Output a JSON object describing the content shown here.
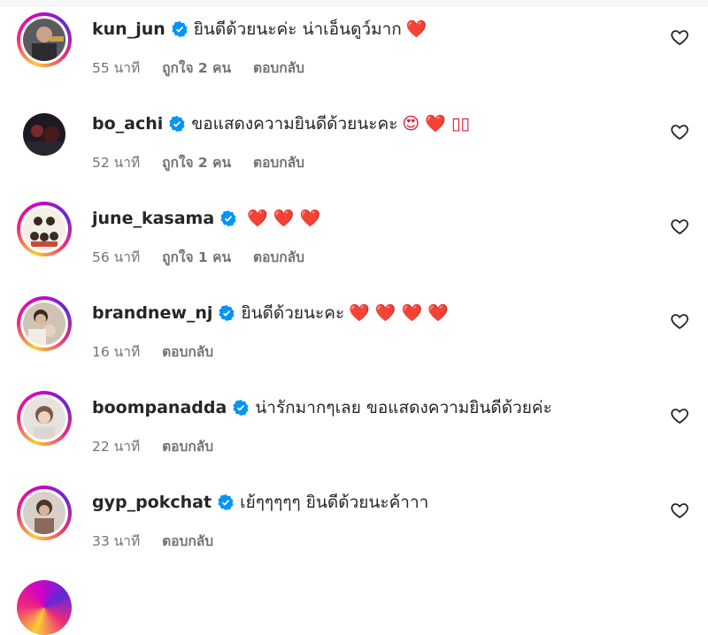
{
  "comments": [
    {
      "username": "kun_jun",
      "text": "ยินดีด้วยนะค่ะ น่าเอ็นดูว์มาก",
      "emoji": "❤️",
      "time": "55 นาที",
      "likes": "ถูกใจ 2 คน",
      "reply": "ตอบกลับ"
    },
    {
      "username": "bo_achi",
      "text": "ขอแสดงความยินดีด้วยนะคะ",
      "emoji": "😍 ❤️ ▯▯",
      "time": "52 นาที",
      "likes": "ถูกใจ 2 คน",
      "reply": "ตอบกลับ"
    },
    {
      "username": "june_kasama",
      "text": "",
      "emoji": "❤️ ❤️ ❤️",
      "time": "56 นาที",
      "likes": "ถูกใจ 1 คน",
      "reply": "ตอบกลับ"
    },
    {
      "username": "brandnew_nj",
      "text": "ยินดีด้วยนะคะ",
      "emoji": "❤️ ❤️ ❤️ ❤️",
      "time": "16 นาที",
      "likes": "",
      "reply": "ตอบกลับ"
    },
    {
      "username": "boompanadda",
      "text": "น่ารักมากๆเลย ขอแสดงความยินดีด้วยค่ะ",
      "emoji": "",
      "time": "22 นาที",
      "likes": "",
      "reply": "ตอบกลับ"
    },
    {
      "username": "gyp_pokchat",
      "text": "เย้ๆๆๆๆๆ ยินดีด้วยนะค้าาา",
      "emoji": "",
      "time": "33 นาที",
      "likes": "",
      "reply": "ตอบกลับ"
    }
  ],
  "colors": {
    "text": "#262626",
    "meta": "#737373",
    "verified": "#0095f6",
    "heart": "#e0102b"
  },
  "icons": {
    "verified": "verified-badge-icon",
    "like": "heart-outline-icon"
  }
}
